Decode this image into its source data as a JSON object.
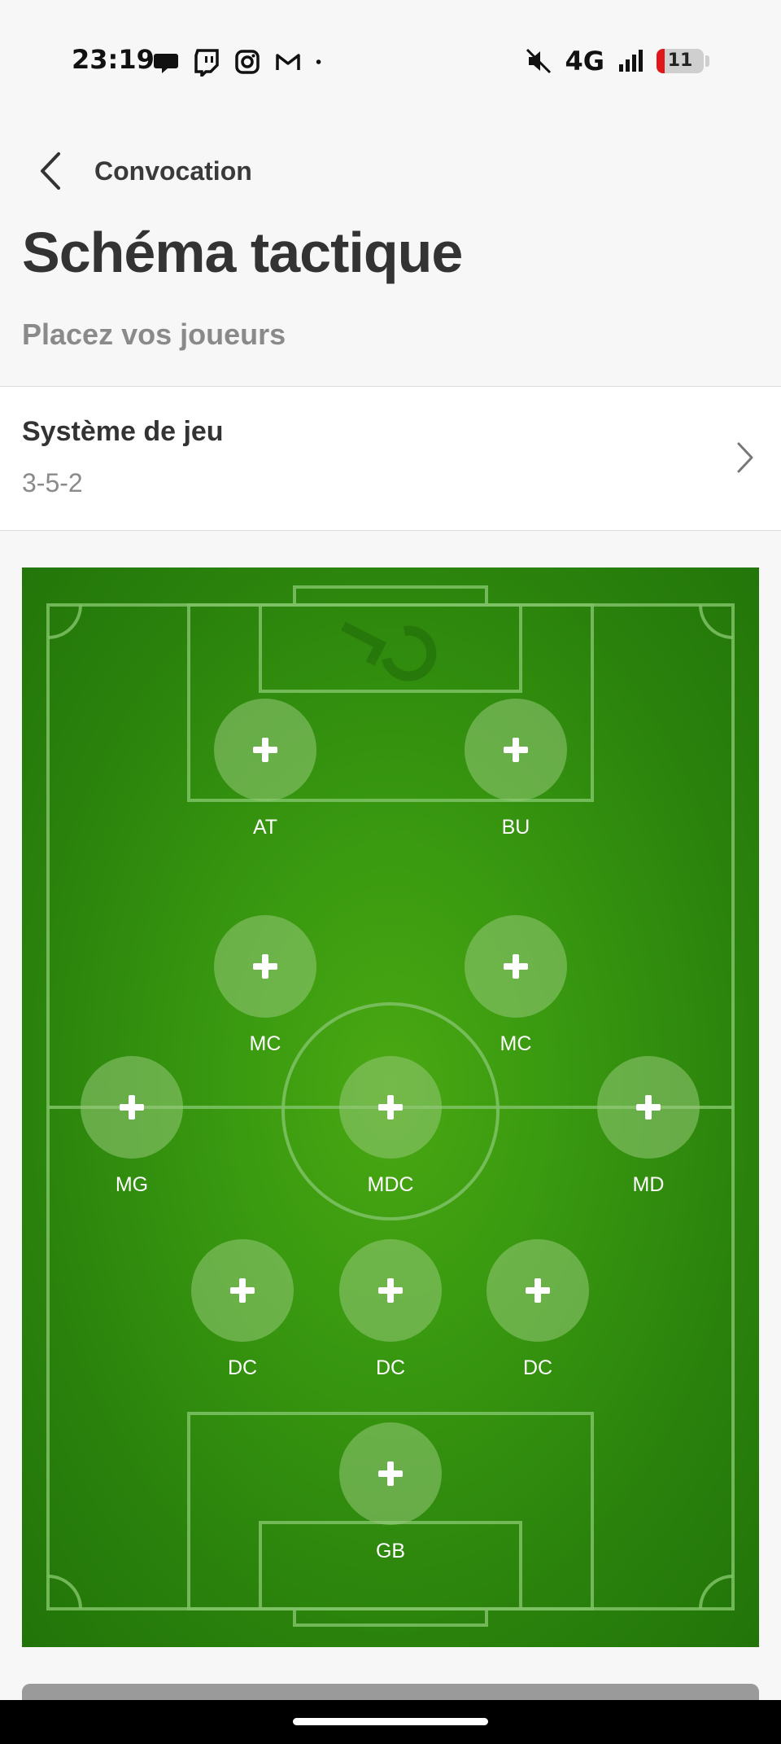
{
  "status_bar": {
    "time": "23:19",
    "left_icons": [
      "chat-bubble-icon",
      "twitch-icon",
      "instagram-icon",
      "gmail-icon",
      "dot-icon"
    ],
    "right_icons": [
      "mute-icon",
      "network-4g",
      "signal-icon",
      "battery-icon"
    ],
    "network": "4G",
    "battery_level": "11",
    "battery_fraction": 0.11,
    "battery_color": "#e0161b"
  },
  "nav": {
    "back_icon": "chevron-left-icon",
    "title": "Convocation"
  },
  "header": {
    "title": "Schéma tactique",
    "subtitle": "Placez vos joueurs"
  },
  "system": {
    "label": "Système de jeu",
    "value": "3-5-2",
    "chevron_icon": "chevron-right-icon"
  },
  "pitch": {
    "grass_color": "#3a9a10",
    "line_color": "#7fc266",
    "slots": [
      {
        "label": "AT"
      },
      {
        "label": "BU"
      },
      {
        "label": "MC"
      },
      {
        "label": "MC"
      },
      {
        "label": "MG"
      },
      {
        "label": "MDC"
      },
      {
        "label": "MD"
      },
      {
        "label": "DC"
      },
      {
        "label": "DC"
      },
      {
        "label": "DC"
      },
      {
        "label": "GB"
      }
    ]
  }
}
